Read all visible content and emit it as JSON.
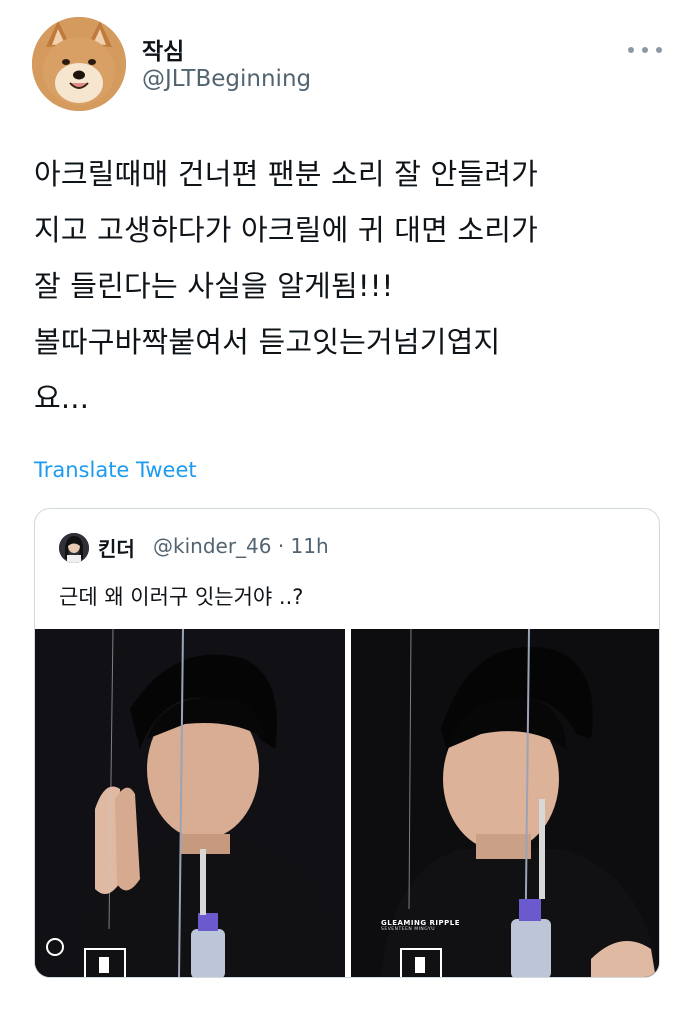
{
  "author": {
    "display_name": "작심",
    "handle": "@JLTBeginning",
    "avatar_icon": "shiba-dog-avatar"
  },
  "tweet": {
    "text": "아크릴때매 건너편 팬분 소리 잘 안들려가\n지고 고생하다가 아크릴에 귀 대면 소리가\n잘 들린다는 사실을 알게됨!!!\n볼따구바짝붙여서 듣고잇는거넘기엽지\n요...",
    "translate_label": "Translate Tweet"
  },
  "more_icon": "more-horizontal-icon",
  "quoted": {
    "display_name": "킨더",
    "handle_time": "@kinder_46 · 11h",
    "text": "근데 왜 이러구 잇는거야 ..?",
    "photo_watermark": "GLEAMING RIPPLE",
    "photo_watermark_sub": "SEVENTEEN MINGYU"
  },
  "colors": {
    "link": "#1d9bf0",
    "secondary_text": "#536471",
    "border": "#cfd9de"
  }
}
